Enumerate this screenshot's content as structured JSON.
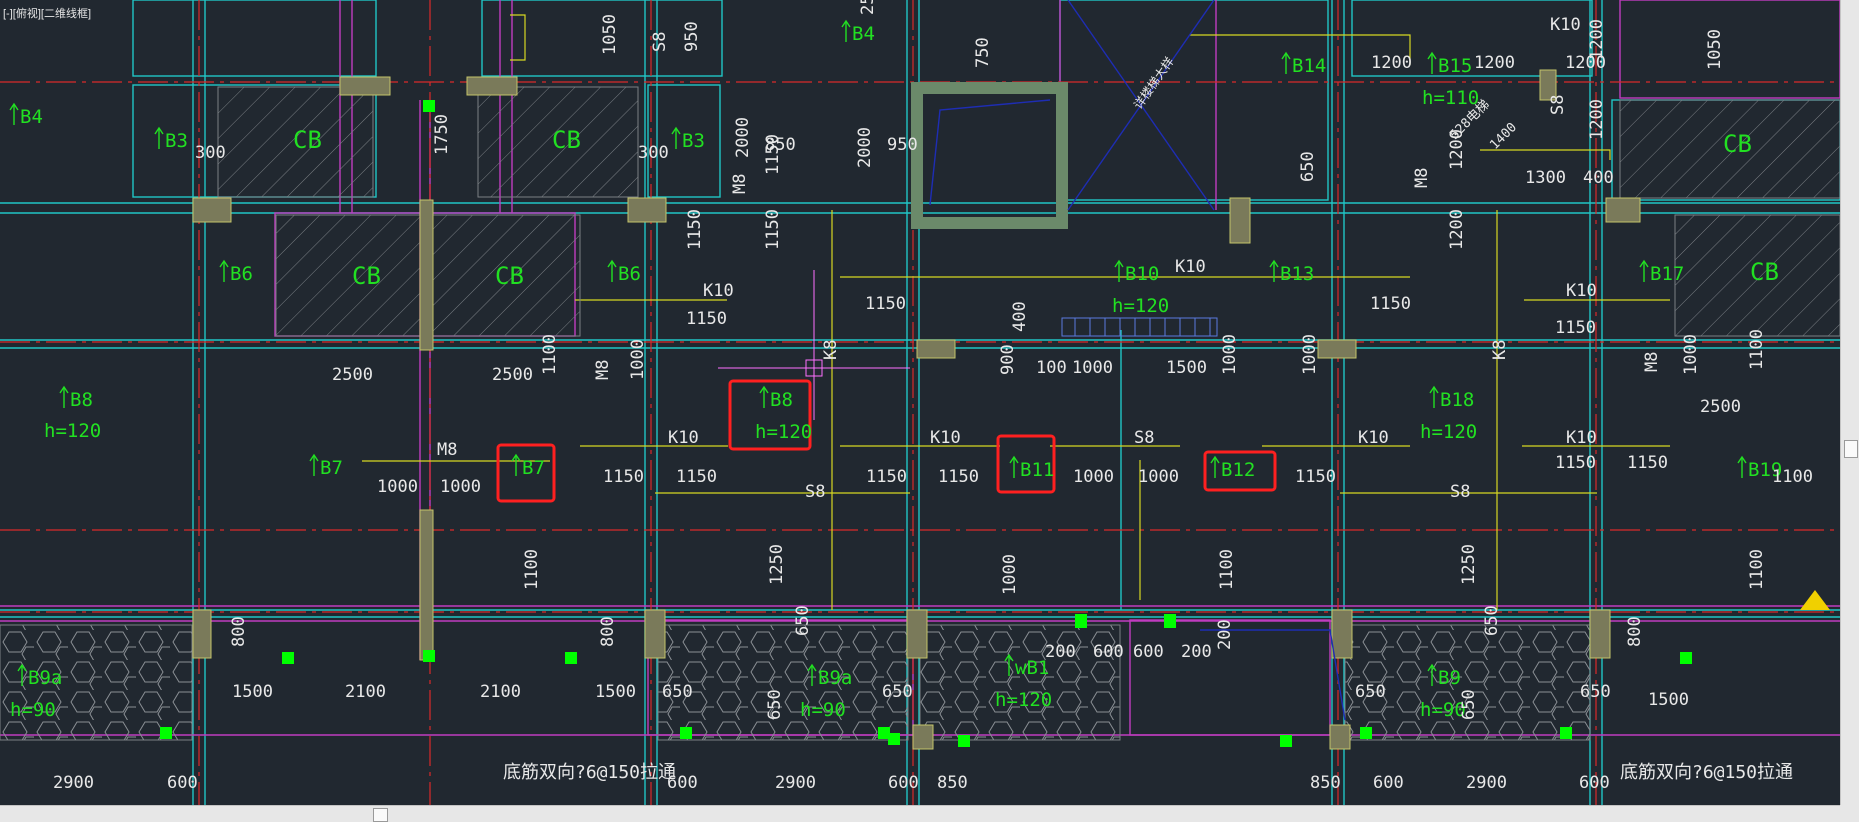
{
  "viewport_label": "[-][俯视][二维线框]",
  "annotations": {
    "stair": "详楼梯大样",
    "elevator": "528\n电梯\n1400",
    "note_left": "底筋双向?6@150拉通",
    "note_right": "底筋双向?6@150拉通"
  },
  "colors": {
    "background": "#212830",
    "slab_label": "#22e022",
    "dimension": "#e8e8e8",
    "wall_cyan": "#21c6c6",
    "beam_magenta": "#c03cc0",
    "axis_red": "#d92a2a",
    "yellow": "#d7d722",
    "highlight": "#ff2020",
    "column_fill": "#7a7a5a"
  },
  "icons": {
    "warning": "yellow-triangle-icon"
  }
}
